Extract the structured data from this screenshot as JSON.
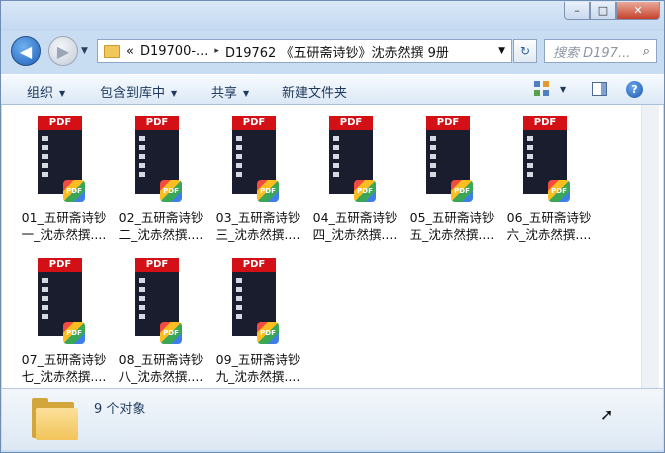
{
  "window": {
    "controls": {
      "minimize": "–",
      "maximize": "□",
      "close": "✕"
    }
  },
  "nav": {
    "back_icon": "◀",
    "forward_icon": "▶",
    "address": {
      "chevron": "«",
      "crumbs": [
        "D19700-...",
        "D19762 《五研斋诗钞》沈赤然撰 9册"
      ],
      "separator": "▸"
    },
    "search_placeholder": "搜索 D197..."
  },
  "toolbar": {
    "organize": "组织",
    "include_in_library": "包含到库中",
    "share": "共享",
    "new_folder": "新建文件夹"
  },
  "files": [
    {
      "line1": "01_五研斋诗钞",
      "line2": "一_沈赤然撰...."
    },
    {
      "line1": "02_五研斋诗钞",
      "line2": "二_沈赤然撰...."
    },
    {
      "line1": "03_五研斋诗钞",
      "line2": "三_沈赤然撰...."
    },
    {
      "line1": "04_五研斋诗钞",
      "line2": "四_沈赤然撰...."
    },
    {
      "line1": "05_五研斋诗钞",
      "line2": "五_沈赤然撰...."
    },
    {
      "line1": "06_五研斋诗钞",
      "line2": "六_沈赤然撰...."
    },
    {
      "line1": "07_五研斋诗钞",
      "line2": "七_沈赤然撰...."
    },
    {
      "line1": "08_五研斋诗钞",
      "line2": "八_沈赤然撰...."
    },
    {
      "line1": "09_五研斋诗钞",
      "line2": "九_沈赤然撰...."
    }
  ],
  "pdf_label": "PDF",
  "status": {
    "count_text": "9 个对象"
  },
  "icons": {
    "file": "pdf-document-icon",
    "status_folder": "folder-icon"
  }
}
